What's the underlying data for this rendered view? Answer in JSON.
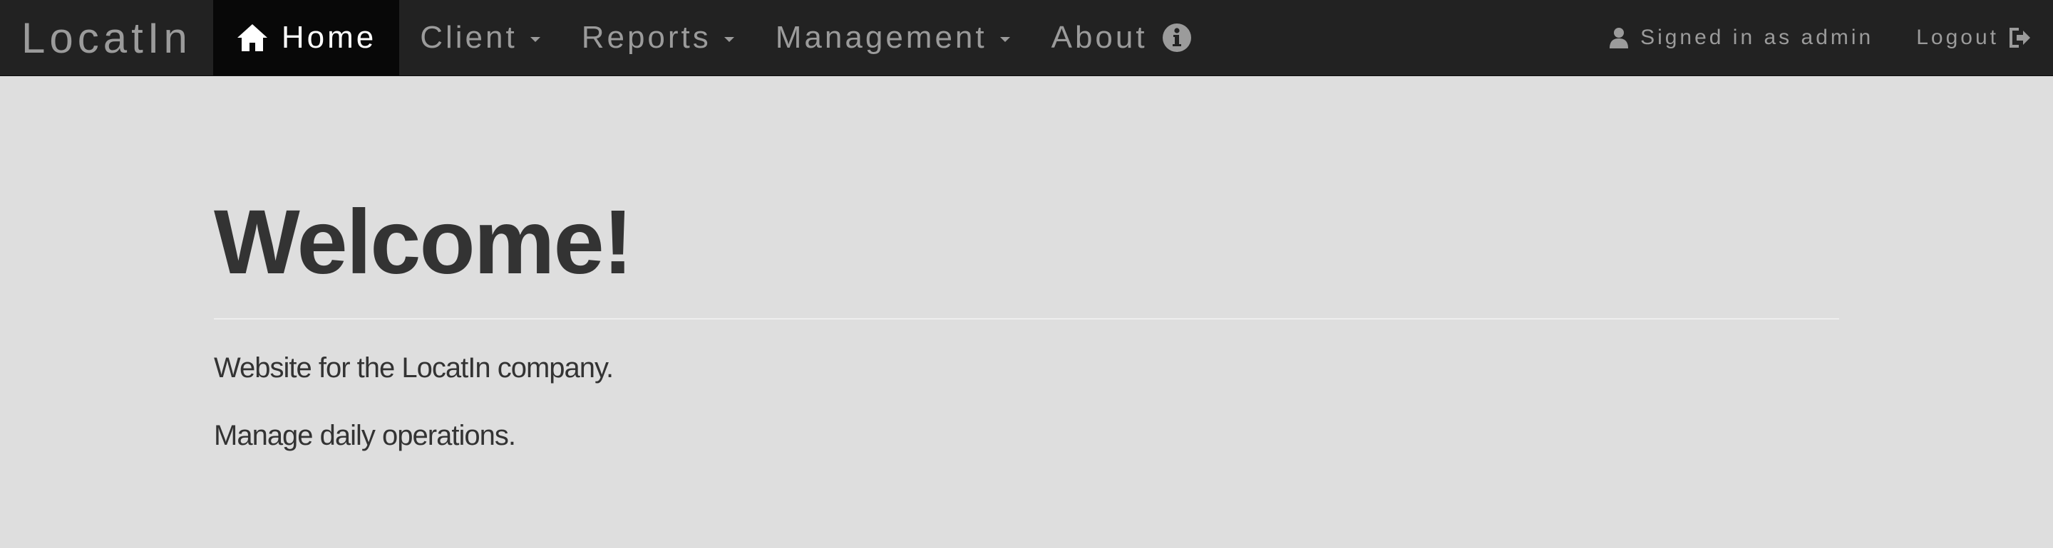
{
  "navbar": {
    "brand": "LocatIn",
    "items": [
      {
        "label": "Home",
        "icon": "home-icon",
        "active": true
      },
      {
        "label": "Client",
        "dropdown": true
      },
      {
        "label": "Reports",
        "dropdown": true
      },
      {
        "label": "Management",
        "dropdown": true
      },
      {
        "label": "About",
        "icon": "info-icon"
      }
    ],
    "user": {
      "label": "Signed in as admin",
      "icon": "user-icon"
    },
    "logout": {
      "label": "Logout",
      "icon": "logout-icon"
    }
  },
  "main": {
    "title": "Welcome!",
    "paragraphs": [
      "Website for the LocatIn company.",
      "Manage daily operations."
    ]
  },
  "colors": {
    "navbar_bg": "#222222",
    "active_bg": "#080808",
    "page_bg": "#dedede",
    "nav_text": "#9b9b9b",
    "heading_text": "#333333"
  }
}
